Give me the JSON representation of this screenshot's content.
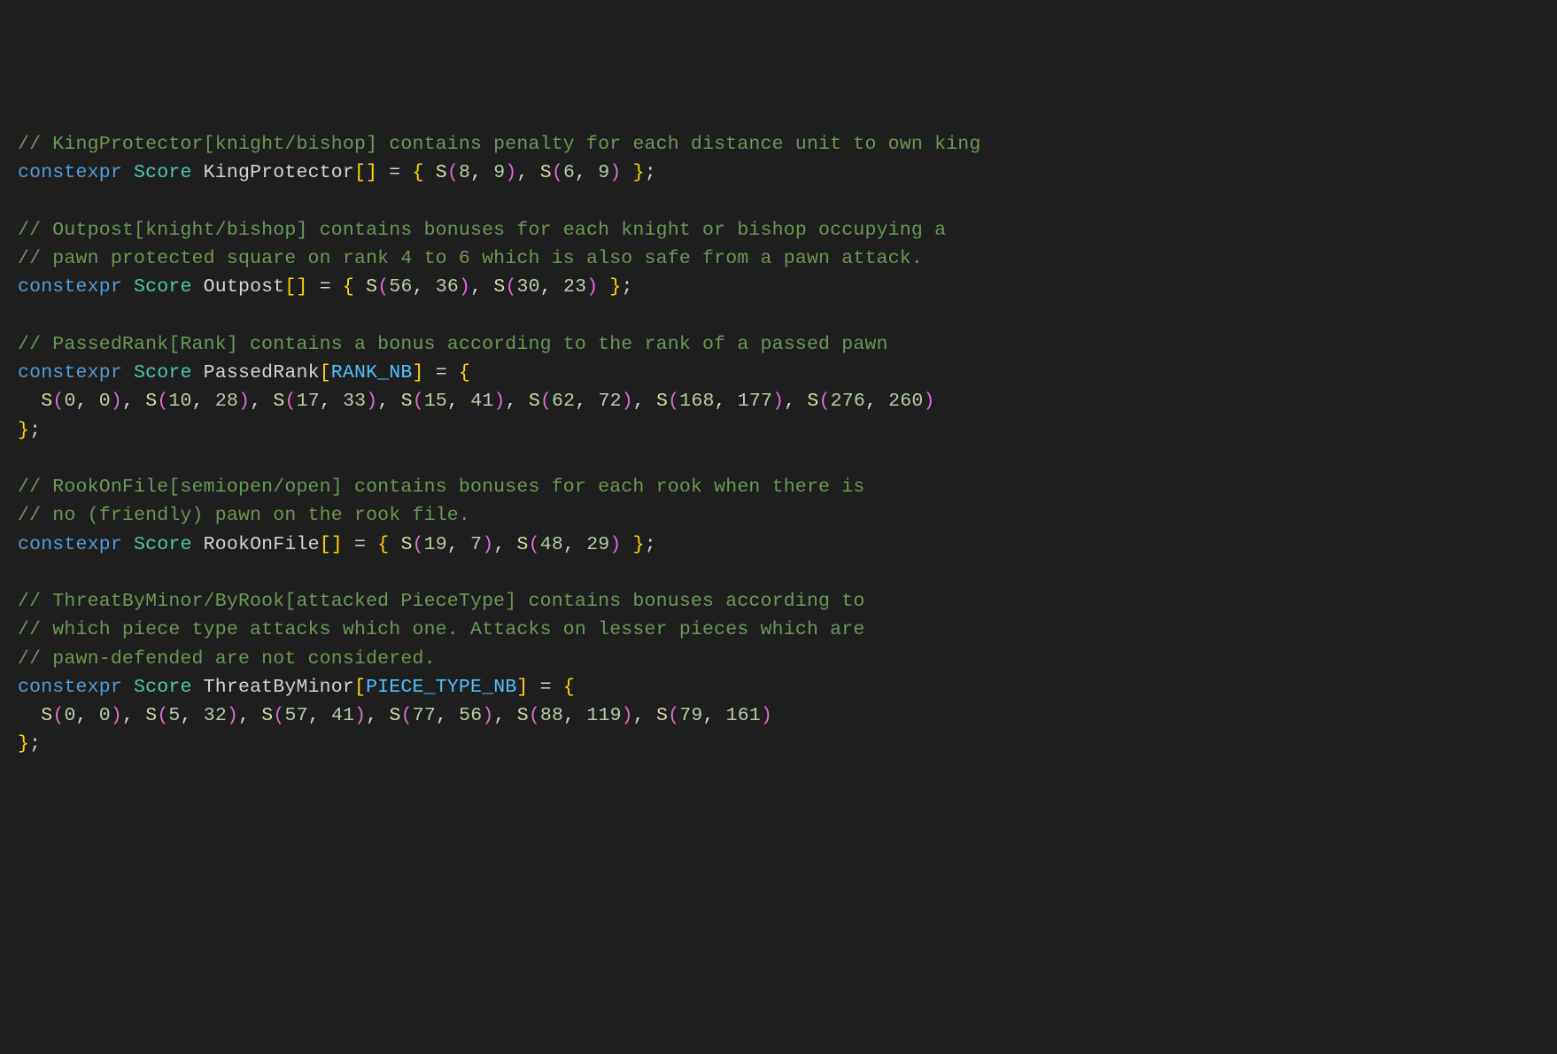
{
  "code": {
    "lines": [
      {
        "tokens": [
          {
            "cls": "comment",
            "t": "// KingProtector[knight/bishop] contains penalty for each distance unit to own king"
          }
        ]
      },
      {
        "tokens": [
          {
            "cls": "keyword",
            "t": "constexpr"
          },
          {
            "cls": "punct",
            "t": " "
          },
          {
            "cls": "type",
            "t": "Score"
          },
          {
            "cls": "punct",
            "t": " "
          },
          {
            "cls": "ident",
            "t": "KingProtector"
          },
          {
            "cls": "bracket1",
            "t": "["
          },
          {
            "cls": "bracket1",
            "t": "]"
          },
          {
            "cls": "punct",
            "t": " = "
          },
          {
            "cls": "bracket1",
            "t": "{"
          },
          {
            "cls": "punct",
            "t": " "
          },
          {
            "cls": "func",
            "t": "S"
          },
          {
            "cls": "bracket2",
            "t": "("
          },
          {
            "cls": "num",
            "t": "8"
          },
          {
            "cls": "punct",
            "t": ", "
          },
          {
            "cls": "num",
            "t": "9"
          },
          {
            "cls": "bracket2",
            "t": ")"
          },
          {
            "cls": "punct",
            "t": ", "
          },
          {
            "cls": "func",
            "t": "S"
          },
          {
            "cls": "bracket2",
            "t": "("
          },
          {
            "cls": "num",
            "t": "6"
          },
          {
            "cls": "punct",
            "t": ", "
          },
          {
            "cls": "num",
            "t": "9"
          },
          {
            "cls": "bracket2",
            "t": ")"
          },
          {
            "cls": "punct",
            "t": " "
          },
          {
            "cls": "bracket1",
            "t": "}"
          },
          {
            "cls": "punct",
            "t": ";"
          }
        ]
      },
      {
        "tokens": []
      },
      {
        "tokens": [
          {
            "cls": "comment",
            "t": "// Outpost[knight/bishop] contains bonuses for each knight or bishop occupying a"
          }
        ]
      },
      {
        "tokens": [
          {
            "cls": "comment",
            "t": "// pawn protected square on rank 4 to 6 which is also safe from a pawn attack."
          }
        ]
      },
      {
        "tokens": [
          {
            "cls": "keyword",
            "t": "constexpr"
          },
          {
            "cls": "punct",
            "t": " "
          },
          {
            "cls": "type",
            "t": "Score"
          },
          {
            "cls": "punct",
            "t": " "
          },
          {
            "cls": "ident",
            "t": "Outpost"
          },
          {
            "cls": "bracket1",
            "t": "["
          },
          {
            "cls": "bracket1",
            "t": "]"
          },
          {
            "cls": "punct",
            "t": " = "
          },
          {
            "cls": "bracket1",
            "t": "{"
          },
          {
            "cls": "punct",
            "t": " "
          },
          {
            "cls": "func",
            "t": "S"
          },
          {
            "cls": "bracket2",
            "t": "("
          },
          {
            "cls": "num",
            "t": "56"
          },
          {
            "cls": "punct",
            "t": ", "
          },
          {
            "cls": "num",
            "t": "36"
          },
          {
            "cls": "bracket2",
            "t": ")"
          },
          {
            "cls": "punct",
            "t": ", "
          },
          {
            "cls": "func",
            "t": "S"
          },
          {
            "cls": "bracket2",
            "t": "("
          },
          {
            "cls": "num",
            "t": "30"
          },
          {
            "cls": "punct",
            "t": ", "
          },
          {
            "cls": "num",
            "t": "23"
          },
          {
            "cls": "bracket2",
            "t": ")"
          },
          {
            "cls": "punct",
            "t": " "
          },
          {
            "cls": "bracket1",
            "t": "}"
          },
          {
            "cls": "punct",
            "t": ";"
          }
        ]
      },
      {
        "tokens": []
      },
      {
        "tokens": [
          {
            "cls": "comment",
            "t": "// PassedRank[Rank] contains a bonus according to the rank of a passed pawn"
          }
        ]
      },
      {
        "tokens": [
          {
            "cls": "keyword",
            "t": "constexpr"
          },
          {
            "cls": "punct",
            "t": " "
          },
          {
            "cls": "type",
            "t": "Score"
          },
          {
            "cls": "punct",
            "t": " "
          },
          {
            "cls": "ident",
            "t": "PassedRank"
          },
          {
            "cls": "bracket1",
            "t": "["
          },
          {
            "cls": "const",
            "t": "RANK_NB"
          },
          {
            "cls": "bracket1",
            "t": "]"
          },
          {
            "cls": "punct",
            "t": " = "
          },
          {
            "cls": "bracket1",
            "t": "{"
          }
        ]
      },
      {
        "tokens": [
          {
            "cls": "punct",
            "t": "  "
          },
          {
            "cls": "func",
            "t": "S"
          },
          {
            "cls": "bracket2",
            "t": "("
          },
          {
            "cls": "num",
            "t": "0"
          },
          {
            "cls": "punct",
            "t": ", "
          },
          {
            "cls": "num",
            "t": "0"
          },
          {
            "cls": "bracket2",
            "t": ")"
          },
          {
            "cls": "punct",
            "t": ", "
          },
          {
            "cls": "func",
            "t": "S"
          },
          {
            "cls": "bracket2",
            "t": "("
          },
          {
            "cls": "num",
            "t": "10"
          },
          {
            "cls": "punct",
            "t": ", "
          },
          {
            "cls": "num",
            "t": "28"
          },
          {
            "cls": "bracket2",
            "t": ")"
          },
          {
            "cls": "punct",
            "t": ", "
          },
          {
            "cls": "func",
            "t": "S"
          },
          {
            "cls": "bracket2",
            "t": "("
          },
          {
            "cls": "num",
            "t": "17"
          },
          {
            "cls": "punct",
            "t": ", "
          },
          {
            "cls": "num",
            "t": "33"
          },
          {
            "cls": "bracket2",
            "t": ")"
          },
          {
            "cls": "punct",
            "t": ", "
          },
          {
            "cls": "func",
            "t": "S"
          },
          {
            "cls": "bracket2",
            "t": "("
          },
          {
            "cls": "num",
            "t": "15"
          },
          {
            "cls": "punct",
            "t": ", "
          },
          {
            "cls": "num",
            "t": "41"
          },
          {
            "cls": "bracket2",
            "t": ")"
          },
          {
            "cls": "punct",
            "t": ", "
          },
          {
            "cls": "func",
            "t": "S"
          },
          {
            "cls": "bracket2",
            "t": "("
          },
          {
            "cls": "num",
            "t": "62"
          },
          {
            "cls": "punct",
            "t": ", "
          },
          {
            "cls": "num",
            "t": "72"
          },
          {
            "cls": "bracket2",
            "t": ")"
          },
          {
            "cls": "punct",
            "t": ", "
          },
          {
            "cls": "func",
            "t": "S"
          },
          {
            "cls": "bracket2",
            "t": "("
          },
          {
            "cls": "num",
            "t": "168"
          },
          {
            "cls": "punct",
            "t": ", "
          },
          {
            "cls": "num",
            "t": "177"
          },
          {
            "cls": "bracket2",
            "t": ")"
          },
          {
            "cls": "punct",
            "t": ", "
          },
          {
            "cls": "func",
            "t": "S"
          },
          {
            "cls": "bracket2",
            "t": "("
          },
          {
            "cls": "num",
            "t": "276"
          },
          {
            "cls": "punct",
            "t": ", "
          },
          {
            "cls": "num",
            "t": "260"
          },
          {
            "cls": "bracket2",
            "t": ")"
          }
        ]
      },
      {
        "tokens": [
          {
            "cls": "bracket1",
            "t": "}"
          },
          {
            "cls": "punct",
            "t": ";"
          }
        ]
      },
      {
        "tokens": []
      },
      {
        "tokens": [
          {
            "cls": "comment",
            "t": "// RookOnFile[semiopen/open] contains bonuses for each rook when there is"
          }
        ]
      },
      {
        "tokens": [
          {
            "cls": "comment",
            "t": "// no (friendly) pawn on the rook file."
          }
        ]
      },
      {
        "tokens": [
          {
            "cls": "keyword",
            "t": "constexpr"
          },
          {
            "cls": "punct",
            "t": " "
          },
          {
            "cls": "type",
            "t": "Score"
          },
          {
            "cls": "punct",
            "t": " "
          },
          {
            "cls": "ident",
            "t": "RookOnFile"
          },
          {
            "cls": "bracket1",
            "t": "["
          },
          {
            "cls": "bracket1",
            "t": "]"
          },
          {
            "cls": "punct",
            "t": " = "
          },
          {
            "cls": "bracket1",
            "t": "{"
          },
          {
            "cls": "punct",
            "t": " "
          },
          {
            "cls": "func",
            "t": "S"
          },
          {
            "cls": "bracket2",
            "t": "("
          },
          {
            "cls": "num",
            "t": "19"
          },
          {
            "cls": "punct",
            "t": ", "
          },
          {
            "cls": "num",
            "t": "7"
          },
          {
            "cls": "bracket2",
            "t": ")"
          },
          {
            "cls": "punct",
            "t": ", "
          },
          {
            "cls": "func",
            "t": "S"
          },
          {
            "cls": "bracket2",
            "t": "("
          },
          {
            "cls": "num",
            "t": "48"
          },
          {
            "cls": "punct",
            "t": ", "
          },
          {
            "cls": "num",
            "t": "29"
          },
          {
            "cls": "bracket2",
            "t": ")"
          },
          {
            "cls": "punct",
            "t": " "
          },
          {
            "cls": "bracket1",
            "t": "}"
          },
          {
            "cls": "punct",
            "t": ";"
          }
        ]
      },
      {
        "tokens": []
      },
      {
        "tokens": [
          {
            "cls": "comment",
            "t": "// ThreatByMinor/ByRook[attacked PieceType] contains bonuses according to"
          }
        ]
      },
      {
        "tokens": [
          {
            "cls": "comment",
            "t": "// which piece type attacks which one. Attacks on lesser pieces which are"
          }
        ]
      },
      {
        "tokens": [
          {
            "cls": "comment",
            "t": "// pawn-defended are not considered."
          }
        ]
      },
      {
        "tokens": [
          {
            "cls": "keyword",
            "t": "constexpr"
          },
          {
            "cls": "punct",
            "t": " "
          },
          {
            "cls": "type",
            "t": "Score"
          },
          {
            "cls": "punct",
            "t": " "
          },
          {
            "cls": "ident",
            "t": "ThreatByMinor"
          },
          {
            "cls": "bracket1",
            "t": "["
          },
          {
            "cls": "const",
            "t": "PIECE_TYPE_NB"
          },
          {
            "cls": "bracket1",
            "t": "]"
          },
          {
            "cls": "punct",
            "t": " = "
          },
          {
            "cls": "bracket1",
            "t": "{"
          }
        ]
      },
      {
        "tokens": [
          {
            "cls": "punct",
            "t": "  "
          },
          {
            "cls": "func",
            "t": "S"
          },
          {
            "cls": "bracket2",
            "t": "("
          },
          {
            "cls": "num",
            "t": "0"
          },
          {
            "cls": "punct",
            "t": ", "
          },
          {
            "cls": "num",
            "t": "0"
          },
          {
            "cls": "bracket2",
            "t": ")"
          },
          {
            "cls": "punct",
            "t": ", "
          },
          {
            "cls": "func",
            "t": "S"
          },
          {
            "cls": "bracket2",
            "t": "("
          },
          {
            "cls": "num",
            "t": "5"
          },
          {
            "cls": "punct",
            "t": ", "
          },
          {
            "cls": "num",
            "t": "32"
          },
          {
            "cls": "bracket2",
            "t": ")"
          },
          {
            "cls": "punct",
            "t": ", "
          },
          {
            "cls": "func",
            "t": "S"
          },
          {
            "cls": "bracket2",
            "t": "("
          },
          {
            "cls": "num",
            "t": "57"
          },
          {
            "cls": "punct",
            "t": ", "
          },
          {
            "cls": "num",
            "t": "41"
          },
          {
            "cls": "bracket2",
            "t": ")"
          },
          {
            "cls": "punct",
            "t": ", "
          },
          {
            "cls": "func",
            "t": "S"
          },
          {
            "cls": "bracket2",
            "t": "("
          },
          {
            "cls": "num",
            "t": "77"
          },
          {
            "cls": "punct",
            "t": ", "
          },
          {
            "cls": "num",
            "t": "56"
          },
          {
            "cls": "bracket2",
            "t": ")"
          },
          {
            "cls": "punct",
            "t": ", "
          },
          {
            "cls": "func",
            "t": "S"
          },
          {
            "cls": "bracket2",
            "t": "("
          },
          {
            "cls": "num",
            "t": "88"
          },
          {
            "cls": "punct",
            "t": ", "
          },
          {
            "cls": "num",
            "t": "119"
          },
          {
            "cls": "bracket2",
            "t": ")"
          },
          {
            "cls": "punct",
            "t": ", "
          },
          {
            "cls": "func",
            "t": "S"
          },
          {
            "cls": "bracket2",
            "t": "("
          },
          {
            "cls": "num",
            "t": "79"
          },
          {
            "cls": "punct",
            "t": ", "
          },
          {
            "cls": "num",
            "t": "161"
          },
          {
            "cls": "bracket2",
            "t": ")"
          }
        ]
      },
      {
        "tokens": [
          {
            "cls": "bracket1",
            "t": "}"
          },
          {
            "cls": "punct",
            "t": ";"
          }
        ]
      }
    ]
  }
}
